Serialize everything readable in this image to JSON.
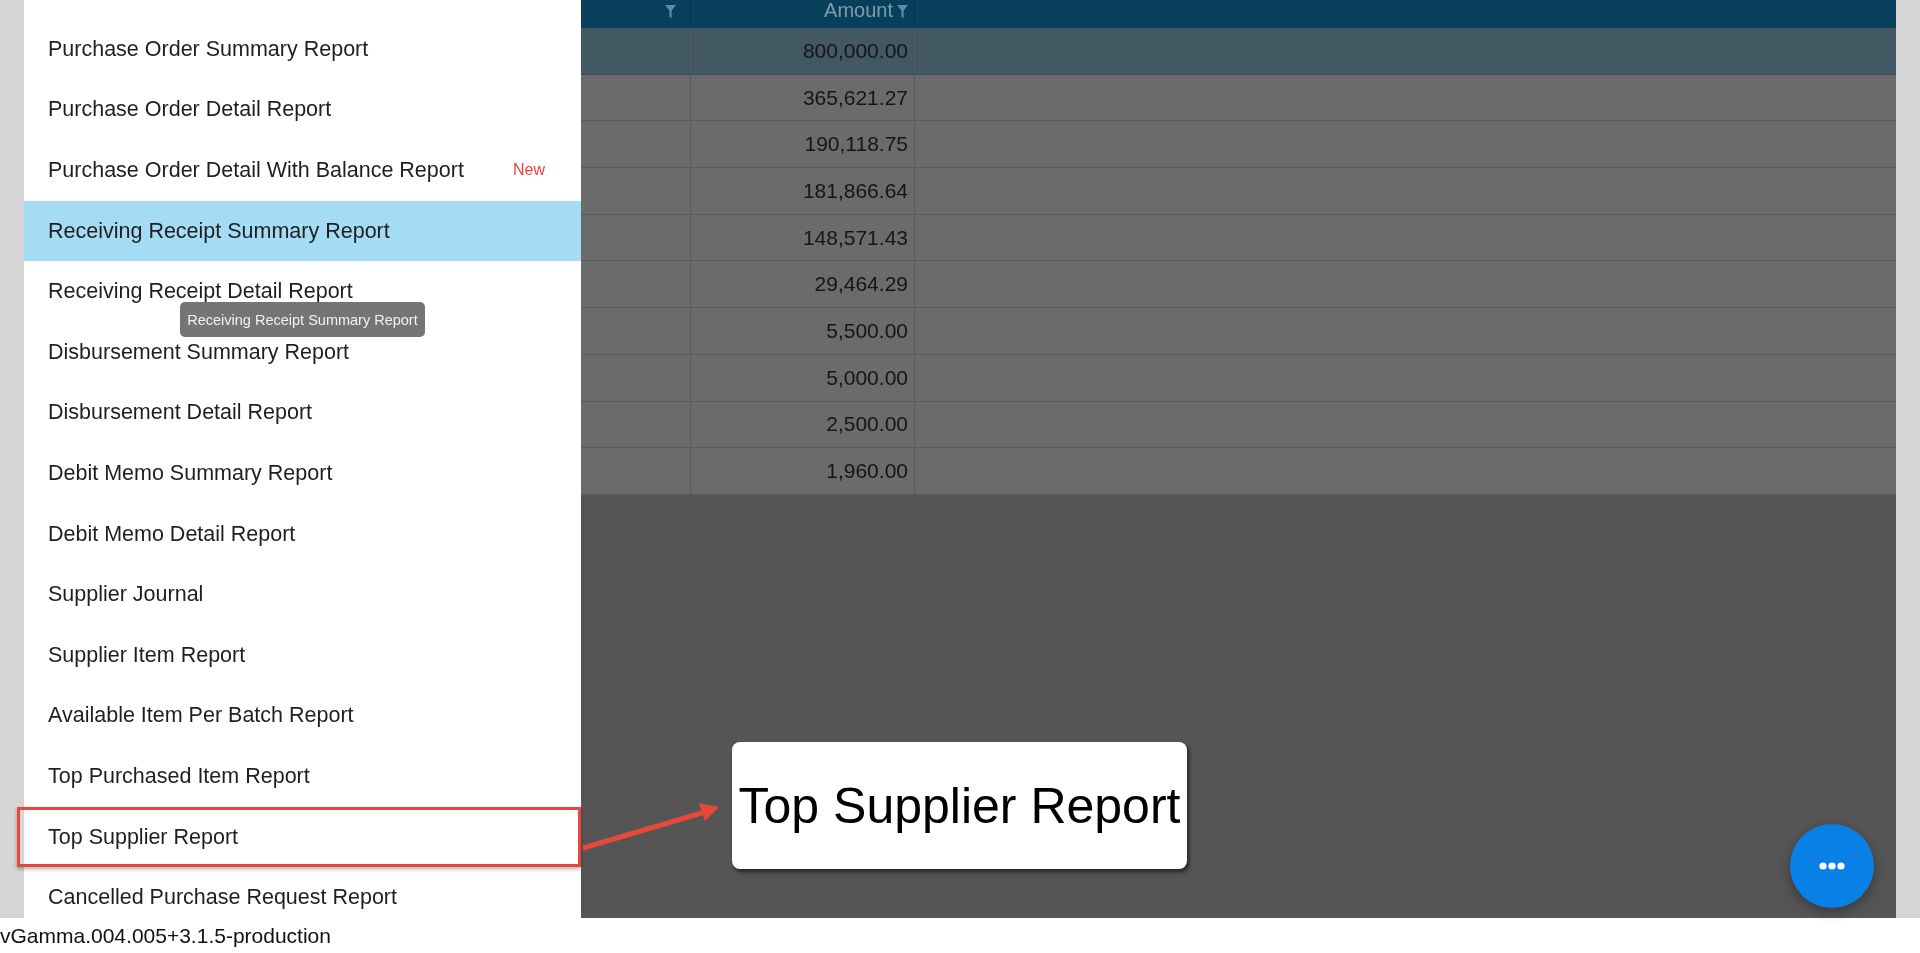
{
  "menu": {
    "items": [
      {
        "label": "Purchase Order Summary Report",
        "selected": false,
        "annotated": false
      },
      {
        "label": "Purchase Order Detail Report",
        "selected": false,
        "annotated": false
      },
      {
        "label": "Purchase Order Detail With Balance Report",
        "selected": false,
        "annotated": false,
        "badge": "New"
      },
      {
        "label": "Receiving Receipt Summary Report",
        "selected": true,
        "annotated": false
      },
      {
        "label": "Receiving Receipt Detail Report",
        "selected": false,
        "annotated": false
      },
      {
        "label": "Disbursement Summary Report",
        "selected": false,
        "annotated": false
      },
      {
        "label": "Disbursement Detail Report",
        "selected": false,
        "annotated": false
      },
      {
        "label": "Debit Memo Summary Report",
        "selected": false,
        "annotated": false
      },
      {
        "label": "Debit Memo Detail Report",
        "selected": false,
        "annotated": false
      },
      {
        "label": "Supplier Journal",
        "selected": false,
        "annotated": false
      },
      {
        "label": "Supplier Item Report",
        "selected": false,
        "annotated": false
      },
      {
        "label": "Available Item Per Batch Report",
        "selected": false,
        "annotated": false
      },
      {
        "label": "Top Purchased Item Report",
        "selected": false,
        "annotated": false
      },
      {
        "label": "Top Supplier Report",
        "selected": false,
        "annotated": true
      },
      {
        "label": "Cancelled Purchase Request Report",
        "selected": false,
        "annotated": false
      }
    ]
  },
  "tooltip": {
    "text": "Receiving Receipt Summary Report"
  },
  "table": {
    "columns": [
      {
        "filter": true
      },
      {
        "label": "Amount",
        "filter": true
      }
    ],
    "rows": [
      {
        "amount": "800,000.00",
        "selected": true
      },
      {
        "amount": "365,621.27",
        "selected": false
      },
      {
        "amount": "190,118.75",
        "selected": false
      },
      {
        "amount": "181,866.64",
        "selected": false
      },
      {
        "amount": "148,571.43",
        "selected": false
      },
      {
        "amount": "29,464.29",
        "selected": false
      },
      {
        "amount": "5,500.00",
        "selected": false
      },
      {
        "amount": "5,000.00",
        "selected": false
      },
      {
        "amount": "2,500.00",
        "selected": false
      },
      {
        "amount": "1,960.00",
        "selected": false
      }
    ]
  },
  "callout": {
    "text": "Top Supplier Report"
  },
  "version": "vGamma.004.005+3.1.5-production"
}
